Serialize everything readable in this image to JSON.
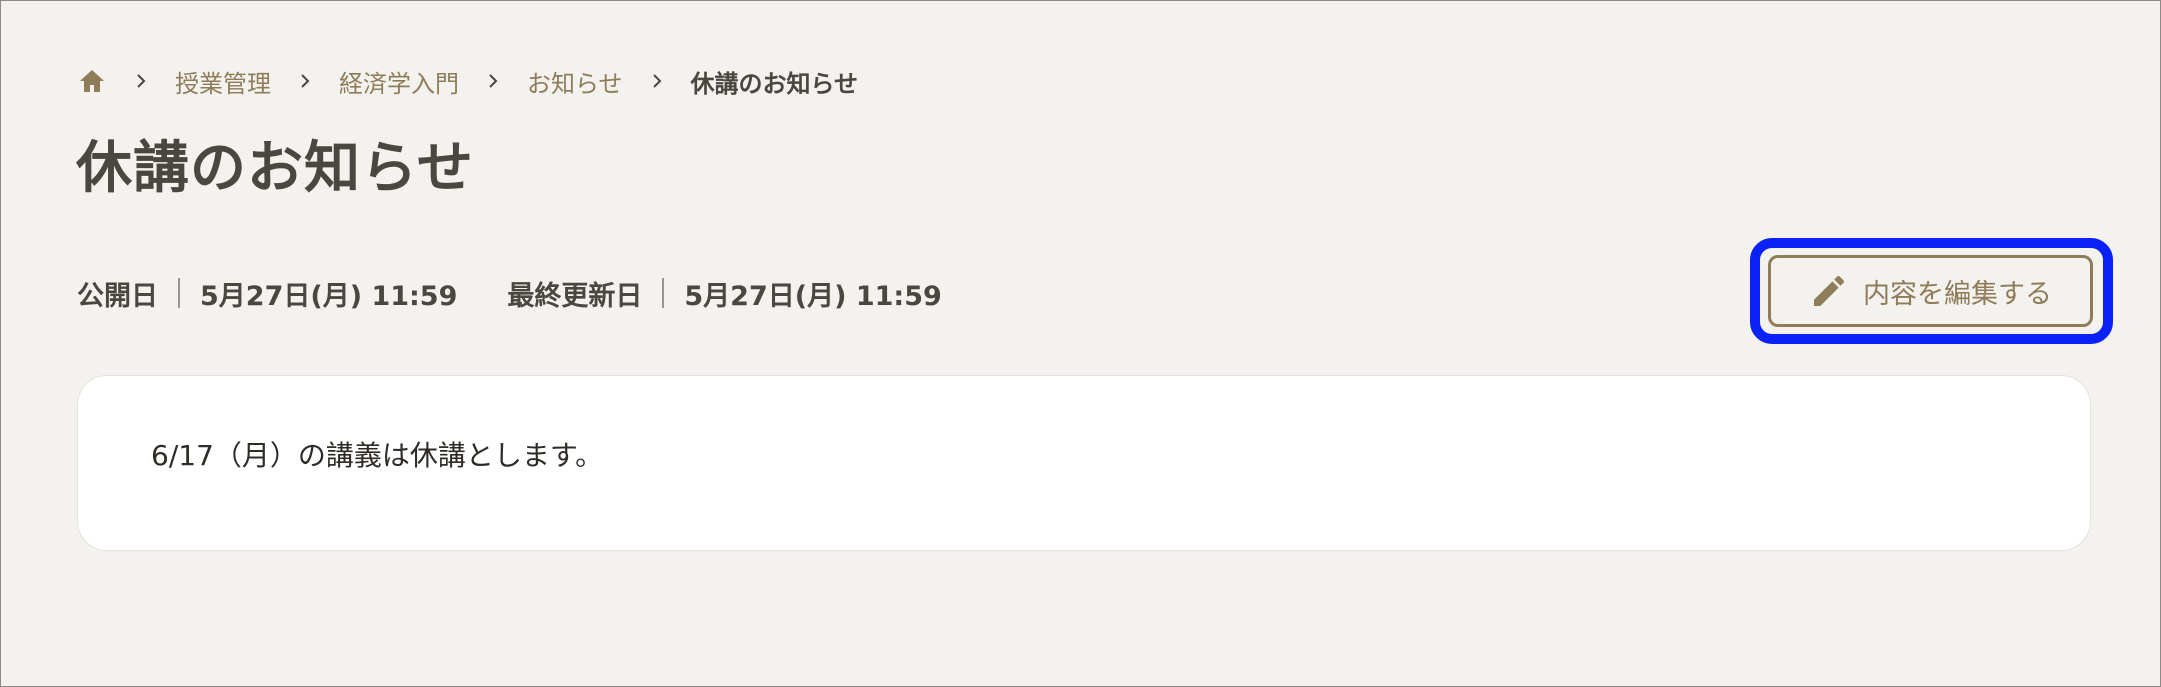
{
  "breadcrumb": {
    "items": [
      "授業管理",
      "経済学入門",
      "お知らせ"
    ],
    "current": "休講のお知らせ"
  },
  "page": {
    "title": "休講のお知らせ"
  },
  "meta": {
    "published_label": "公開日",
    "published_value": "5月27日(月) 11:59",
    "updated_label": "最終更新日",
    "updated_value": "5月27日(月) 11:59"
  },
  "actions": {
    "edit_label": "内容を編集する"
  },
  "content": {
    "body": "6/17（月）の講義は休講とします。"
  },
  "icons": {
    "home": "home-icon",
    "separator": "chevron-right-icon",
    "edit": "pencil-icon"
  },
  "colors": {
    "background": "#f3f2ef",
    "accent": "#8f7c58",
    "text": "#4a4640",
    "highlight": "#0a22f5",
    "card": "#ffffff"
  }
}
